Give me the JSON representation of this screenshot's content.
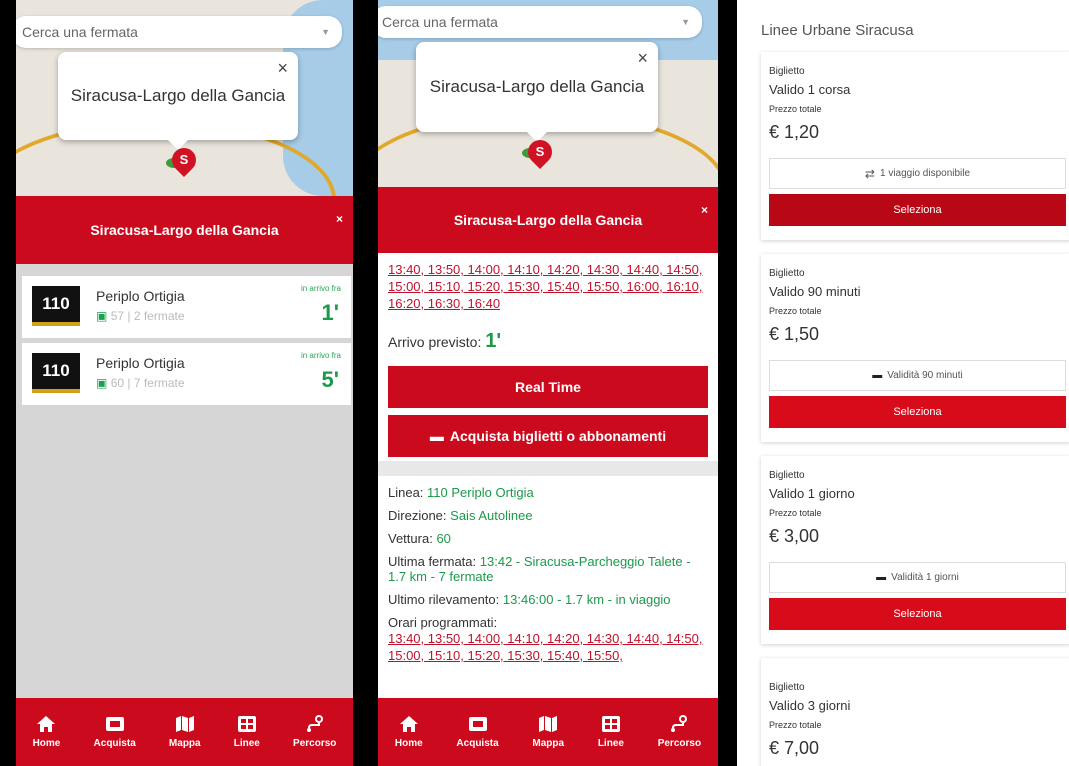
{
  "search_placeholder": "Cerca una fermata",
  "stop_name": "Siracusa-Largo della Gancia",
  "map_bubble_close": "×",
  "pin_letter": "S",
  "panel_close": "×",
  "arrivals": [
    {
      "line": "110",
      "name": "Periplo Ortigia",
      "detail": "57 | 2 fermate",
      "label": "in arrivo fra",
      "minutes": "1'"
    },
    {
      "line": "110",
      "name": "Periplo Ortigia",
      "detail": "60 | 7 fermate",
      "label": "in arrivo fra",
      "minutes": "5'"
    }
  ],
  "timetable": "13:40, 13:50, 14:00, 14:10, 14:20, 14:30, 14:40, 14:50, 15:00, 15:10, 15:20, 15:30, 15:40, 15:50, 16:00, 16:10, 16:20, 16:30, 16:40",
  "arrival_expected_label": "Arrivo previsto:",
  "arrival_expected_value": "1'",
  "realtime_button": "Real Time",
  "buy_button": "Acquista biglietti o abbonamenti",
  "info": {
    "linea_label": "Linea:",
    "linea_value": "110 Periplo Ortigia",
    "direzione_label": "Direzione:",
    "direzione_value": "Sais Autolinee",
    "vettura_label": "Vettura:",
    "vettura_value": "60",
    "ultima_label": "Ultima fermata:",
    "ultima_value": "13:42 - Siracusa-Parcheggio Talete - 1.7 km - 7 fermate",
    "rilev_label": "Ultimo rilevamento:",
    "rilev_value": "13:46:00 - 1.7 km - in viaggio",
    "orari_label": "Orari programmati:",
    "orari_value": "13:40, 13:50, 14:00, 14:10, 14:20, 14:30, 14:40, 14:50, 15:00, 15:10, 15:20, 15:30, 15:40, 15:50,"
  },
  "nav": [
    {
      "label": "Home",
      "icon": "home-icon"
    },
    {
      "label": "Acquista",
      "icon": "ticket-icon"
    },
    {
      "label": "Mappa",
      "icon": "map-icon"
    },
    {
      "label": "Linee",
      "icon": "lines-icon"
    },
    {
      "label": "Percorso",
      "icon": "route-icon"
    }
  ],
  "tickets_title": "Linee Urbane Siracusa",
  "tickets": [
    {
      "kind": "Biglietto",
      "name": "Valido 1 corsa",
      "price_label": "Prezzo totale",
      "price": "€ 1,20",
      "option_icon": "⇄",
      "option": "1 viaggio disponibile",
      "select": "Seleziona"
    },
    {
      "kind": "Biglietto",
      "name": "Valido 90 minuti",
      "price_label": "Prezzo totale",
      "price": "€ 1,50",
      "option_icon": "▬",
      "option": "Validità 90 minuti",
      "select": "Seleziona"
    },
    {
      "kind": "Biglietto",
      "name": "Valido 1 giorno",
      "price_label": "Prezzo totale",
      "price": "€ 3,00",
      "option_icon": "▬",
      "option": "Validità 1 giorni",
      "select": "Seleziona"
    },
    {
      "kind": "Biglietto",
      "name": "Valido 3 giorni",
      "price_label": "Prezzo totale",
      "price": "€ 7,00"
    }
  ],
  "colors": {
    "brand_red": "#cc0a1d",
    "green": "#1b9a4a",
    "line_box": "#111111"
  }
}
